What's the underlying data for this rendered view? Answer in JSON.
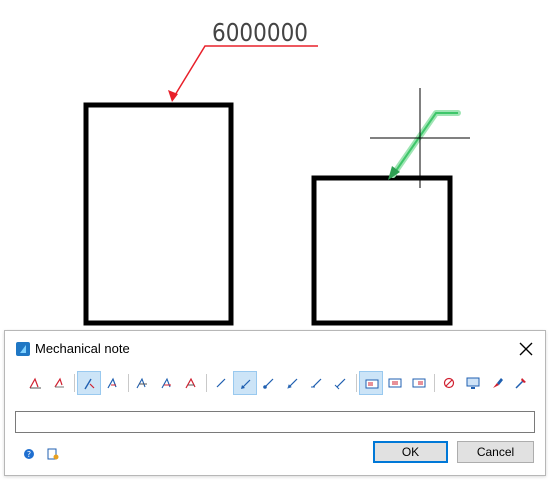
{
  "drawing": {
    "leader_note_text": "6000000"
  },
  "dialog": {
    "title": "Mechanical note",
    "note_input": {
      "value": "",
      "placeholder": ""
    },
    "ok_label": "OK",
    "cancel_label": "Cancel",
    "toolbar": {
      "groups": [
        [
          "note-style-a-icon",
          "note-style-b-icon"
        ],
        [
          "note-style-c-icon",
          "note-style-d-icon"
        ],
        [
          "note-style-e-icon",
          "note-style-f-icon",
          "note-style-g-icon"
        ],
        [
          "leader-straight-icon",
          "leader-arrow-icon",
          "leader-dot-icon",
          "leader-curve-icon",
          "leader-angle-icon",
          "leader-slash-icon"
        ],
        [
          "frame-left-icon",
          "frame-center-icon",
          "frame-right-icon"
        ],
        [
          "no-symbol-icon",
          "monitor-icon",
          "paint-icon",
          "tool-icon"
        ]
      ],
      "selected": [
        "note-style-c-icon",
        "leader-arrow-icon",
        "frame-left-icon"
      ]
    },
    "colors": {
      "accent": "#0078d7",
      "selected_bg": "#cce4f7",
      "leader_red": "#e8202a",
      "leader_green": "#3ec66a"
    }
  }
}
